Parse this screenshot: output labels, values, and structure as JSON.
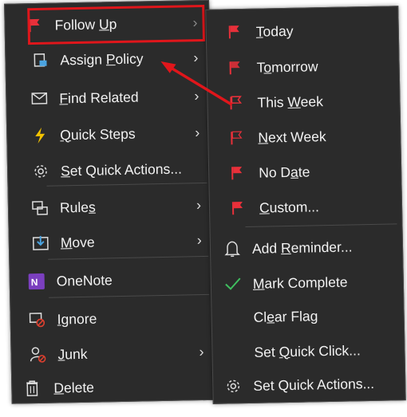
{
  "left_menu": {
    "items": [
      {
        "pre": "Follow ",
        "acc": "U",
        "post": "p",
        "icon": "flag-icon",
        "has_submenu": true,
        "highlighted": true
      },
      {
        "pre": "Assign ",
        "acc": "P",
        "post": "olicy",
        "icon": "policy-icon",
        "has_submenu": true
      },
      {
        "pre": "",
        "acc": "F",
        "post": "ind Related",
        "icon": "envelope-icon",
        "has_submenu": true
      },
      {
        "pre": "",
        "acc": "Q",
        "post": "uick Steps",
        "icon": "lightning-icon",
        "has_submenu": true
      },
      {
        "pre": "",
        "acc": "S",
        "post": "et Quick Actions...",
        "icon": "gear-icon",
        "has_submenu": false
      },
      {
        "pre": "Rule",
        "acc": "s",
        "post": "",
        "icon": "rules-icon",
        "has_submenu": true
      },
      {
        "pre": "",
        "acc": "M",
        "post": "ove",
        "icon": "move-icon",
        "has_submenu": true
      },
      {
        "pre": "OneNote",
        "acc": "",
        "post": "",
        "icon": "onenote-icon",
        "has_submenu": false
      },
      {
        "pre": "",
        "acc": "I",
        "post": "gnore",
        "icon": "ignore-icon",
        "has_submenu": false
      },
      {
        "pre": "",
        "acc": "J",
        "post": "unk",
        "icon": "junk-icon",
        "has_submenu": true
      },
      {
        "pre": "",
        "acc": "D",
        "post": "elete",
        "icon": "trash-icon",
        "has_submenu": false
      }
    ]
  },
  "right_menu": {
    "items": [
      {
        "pre": "",
        "acc": "T",
        "post": "oday",
        "icon": "flag-icon"
      },
      {
        "pre": "T",
        "acc": "o",
        "post": "morrow",
        "icon": "flag-icon"
      },
      {
        "pre": "This ",
        "acc": "W",
        "post": "eek",
        "icon": "flag-icon"
      },
      {
        "pre": "",
        "acc": "N",
        "post": "ext Week",
        "icon": "flag-icon"
      },
      {
        "pre": "No D",
        "acc": "a",
        "post": "te",
        "icon": "flag-icon"
      },
      {
        "pre": "",
        "acc": "C",
        "post": "ustom...",
        "icon": "flag-icon"
      },
      {
        "pre": "Add ",
        "acc": "R",
        "post": "eminder...",
        "icon": "bell-icon"
      },
      {
        "pre": "",
        "acc": "M",
        "post": "ark Complete",
        "icon": "checkmark-icon"
      },
      {
        "pre": "Cl",
        "acc": "e",
        "post": "ar Flag",
        "icon": ""
      },
      {
        "pre": "Set ",
        "acc": "Q",
        "post": "uick Click...",
        "icon": ""
      },
      {
        "pre": "Set Quick Actions...",
        "acc": "",
        "post": "",
        "icon": "gear-icon"
      }
    ]
  },
  "colors": {
    "menu_bg": "#2b2b2b",
    "highlight": "#e0161b",
    "flag": "#e8303a",
    "onenote": "#7b3fbf",
    "check": "#3fbf5f"
  },
  "arrow_glyph": "›"
}
